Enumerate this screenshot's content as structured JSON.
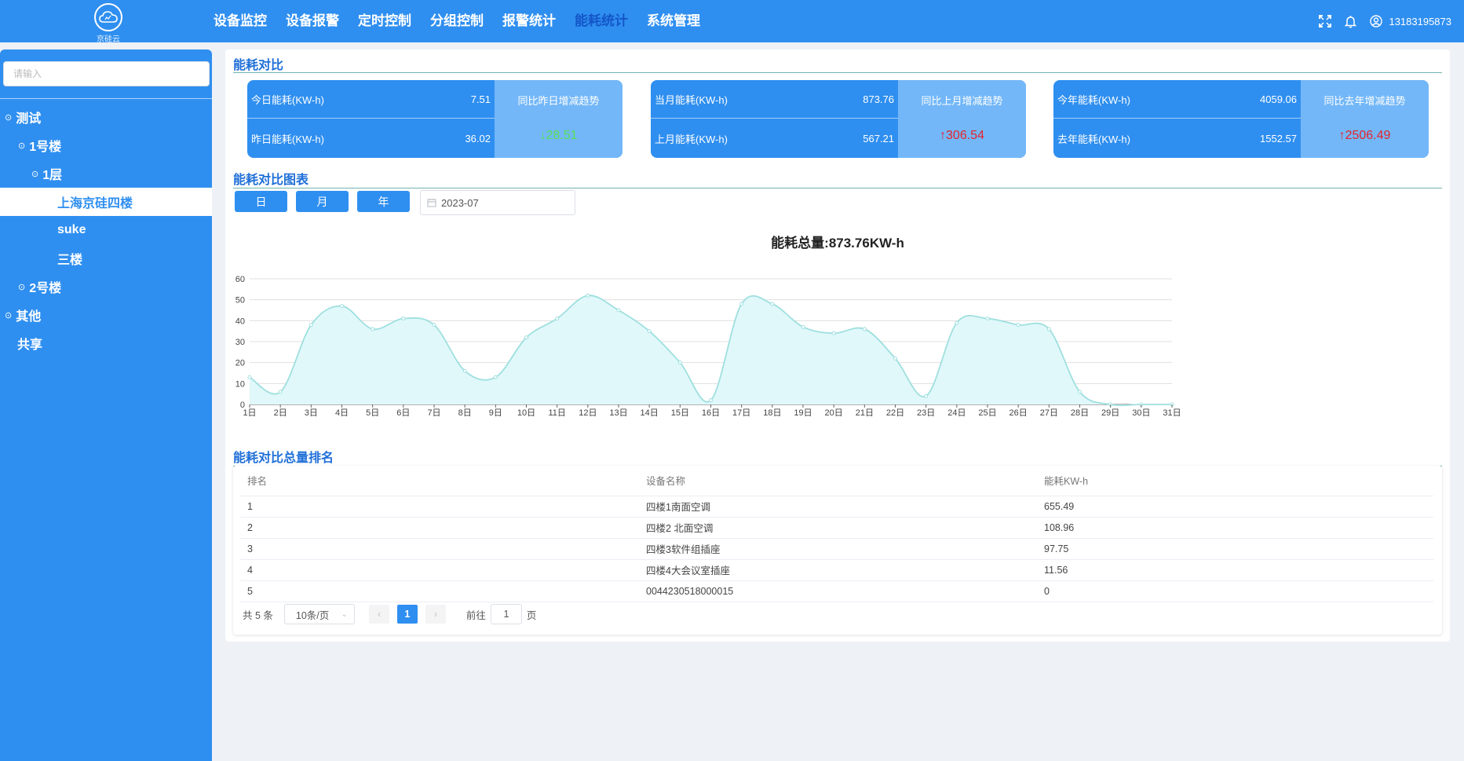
{
  "header": {
    "logo_text": "京硅云",
    "nav": [
      "设备监控",
      "设备报警",
      "定时控制",
      "分组控制",
      "报警统计",
      "能耗统计",
      "系统管理"
    ],
    "active_nav": 5,
    "username": "13183195873"
  },
  "sidebar": {
    "search_placeholder": "请输入",
    "tree": [
      {
        "label": "测试",
        "level": 0,
        "expandable": true
      },
      {
        "label": "1号楼",
        "level": 1,
        "expandable": true
      },
      {
        "label": "1层",
        "level": 2,
        "expandable": true
      },
      {
        "label": "上海京硅四楼",
        "level": 3,
        "expandable": false,
        "selected": true
      },
      {
        "label": "suke",
        "level": 3,
        "expandable": false
      },
      {
        "label": "三楼",
        "level": 3,
        "expandable": false
      },
      {
        "label": "2号楼",
        "level": 1,
        "expandable": true
      },
      {
        "label": "其他",
        "level": 0,
        "expandable": true
      },
      {
        "label": "共享",
        "level": 0,
        "expandable": false
      }
    ]
  },
  "comparison": {
    "title": "能耗对比",
    "cards": [
      {
        "row1_label": "今日能耗(KW-h)",
        "row1_value": "7.51",
        "row2_label": "昨日能耗(KW-h)",
        "row2_value": "36.02",
        "trend_title": "同比昨日增减趋势",
        "trend_arrow": "↓",
        "trend_value": "28.51",
        "direction": "down"
      },
      {
        "row1_label": "当月能耗(KW-h)",
        "row1_value": "873.76",
        "row2_label": "上月能耗(KW-h)",
        "row2_value": "567.21",
        "trend_title": "同比上月增减趋势",
        "trend_arrow": "↑",
        "trend_value": "306.54",
        "direction": "up"
      },
      {
        "row1_label": "今年能耗(KW-h)",
        "row1_value": "4059.06",
        "row2_label": "去年能耗(KW-h)",
        "row2_value": "1552.57",
        "trend_title": "同比去年增减趋势",
        "trend_arrow": "↑",
        "trend_value": "2506.49",
        "direction": "up"
      }
    ]
  },
  "chart_section": {
    "title": "能耗对比图表",
    "buttons": [
      "日",
      "月",
      "年"
    ],
    "date_value": "2023-07"
  },
  "chart_data": {
    "type": "area",
    "title": "能耗总量:873.76KW-h",
    "categories": [
      "1日",
      "2日",
      "3日",
      "4日",
      "5日",
      "6日",
      "7日",
      "8日",
      "9日",
      "10日",
      "11日",
      "12日",
      "13日",
      "14日",
      "15日",
      "16日",
      "17日",
      "18日",
      "19日",
      "20日",
      "21日",
      "22日",
      "23日",
      "24日",
      "25日",
      "26日",
      "27日",
      "28日",
      "29日",
      "30日",
      "31日"
    ],
    "values": [
      13,
      6,
      38,
      47,
      36,
      41,
      38,
      16,
      13,
      32,
      41,
      52,
      45,
      35,
      20,
      2,
      48,
      48,
      37,
      34,
      36,
      22,
      4,
      39,
      41,
      38,
      36,
      6,
      0,
      0,
      0
    ],
    "ylim": [
      0,
      60
    ],
    "yticks": [
      0,
      10,
      20,
      30,
      40,
      50,
      60
    ],
    "grid": true,
    "line_color": "#9fdfdf",
    "fill_color": "#e0f8fa"
  },
  "ranking": {
    "title": "能耗对比总量排名",
    "columns": [
      "排名",
      "设备名称",
      "能耗KW-h"
    ],
    "rows": [
      [
        "1",
        "四楼1南面空调",
        "655.49"
      ],
      [
        "2",
        "四楼2 北面空调",
        "108.96"
      ],
      [
        "3",
        "四楼3软件组插座",
        "97.75"
      ],
      [
        "4",
        "四楼4大会议室插座",
        "11.56"
      ],
      [
        "5",
        "0044230518000015",
        "0"
      ]
    ],
    "pagination": {
      "total_text": "共 5 条",
      "page_size": "10条/页",
      "current_page": "1",
      "goto_label": "前往",
      "goto_value": "1",
      "page_suffix": "页"
    }
  }
}
